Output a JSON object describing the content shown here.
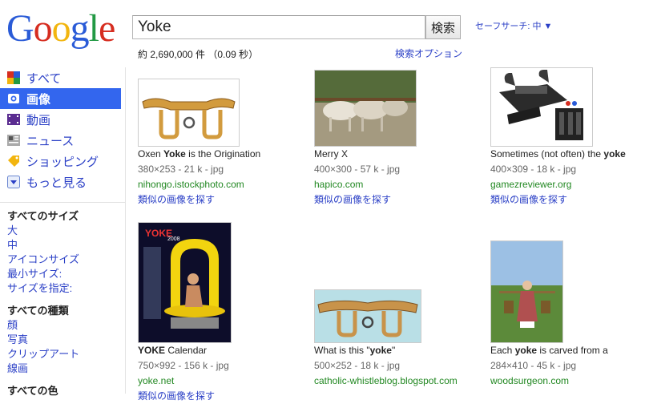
{
  "logo": {
    "letters": [
      "G",
      "o",
      "o",
      "g",
      "l",
      "e"
    ],
    "colors": [
      "#2a5bd7",
      "#d62d20",
      "#f2b50f",
      "#2a5bd7",
      "#229944",
      "#d62d20"
    ]
  },
  "search": {
    "query": "Yoke",
    "button_label": "検索",
    "safesearch": "セーフサーチ: 中 ▼"
  },
  "stats": "約 2,690,000 件 （0.09 秒）",
  "search_options": "検索オプション",
  "nav": [
    {
      "label": "すべて",
      "icon": "all-icon",
      "selected": false
    },
    {
      "label": "画像",
      "icon": "images-icon",
      "selected": true
    },
    {
      "label": "動画",
      "icon": "video-icon",
      "selected": false
    },
    {
      "label": "ニュース",
      "icon": "news-icon",
      "selected": false
    },
    {
      "label": "ショッピング",
      "icon": "shopping-icon",
      "selected": false
    },
    {
      "label": "もっと見る",
      "icon": "more-icon",
      "selected": false
    }
  ],
  "filters": {
    "size": {
      "heading": "すべてのサイズ",
      "items": [
        "大",
        "中",
        "アイコンサイズ",
        "最小サイズ:",
        "サイズを指定:"
      ]
    },
    "type": {
      "heading": "すべての種類",
      "items": [
        "顔",
        "写真",
        "クリップアート",
        "線画"
      ]
    },
    "color": {
      "heading": "すべての色"
    }
  },
  "results": [
    {
      "title_pre": "Oxen ",
      "title_bold": "Yoke",
      "title_post": " is the Origination",
      "meta": "380×253 - 21 k - jpg",
      "url": "nihongo.istockphoto.com",
      "similar": "類似の画像を探す"
    },
    {
      "title_pre": "Merry X",
      "title_bold": "",
      "title_post": "",
      "meta": "400×300 - 57 k - jpg",
      "url": "hapico.com",
      "similar": "類似の画像を探す"
    },
    {
      "title_pre": "Sometimes (not often) the ",
      "title_bold": "yoke",
      "title_post": "",
      "meta": "400×309 - 18 k - jpg",
      "url": "gamezreviewer.org",
      "similar": "類似の画像を探す"
    },
    {
      "title_pre": "",
      "title_bold": "YOKE",
      "title_post": " Calendar",
      "meta": "750×992 - 156 k - jpg",
      "url": "yoke.net",
      "similar": "類似の画像を探す",
      "thumb_text": "YOKE",
      "thumb_year": "2008"
    },
    {
      "title_pre": "What is this \"",
      "title_bold": "yoke",
      "title_post": "\"",
      "meta": "500×252 - 18 k - jpg",
      "url": "catholic-whistleblog.blogspot.com",
      "similar": ""
    },
    {
      "title_pre": "Each ",
      "title_bold": "yoke",
      "title_post": " is carved from a",
      "meta": "284×410 - 45 k - jpg",
      "url": "woodsurgeon.com",
      "similar": ""
    }
  ]
}
